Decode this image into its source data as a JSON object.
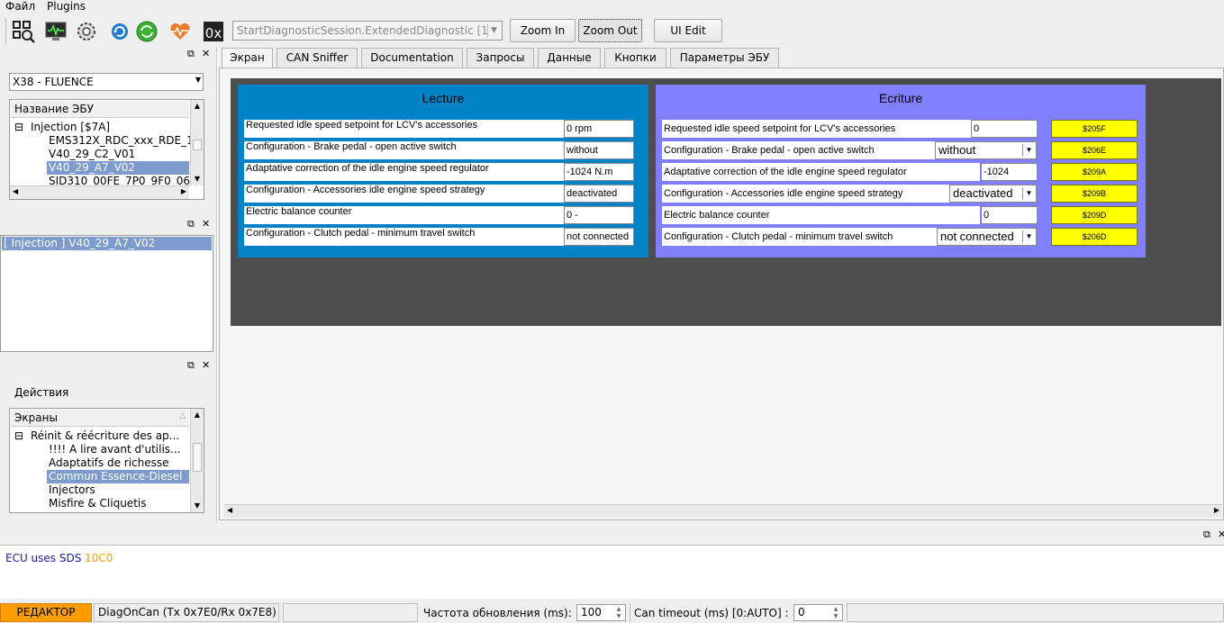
{
  "menu": {
    "file": "Файл",
    "plugins": "Plugins"
  },
  "toolbar": {
    "session_combo": "StartDiagnosticSession.ExtendedDiagnostic [1",
    "hex_label": "0x",
    "zoom_in": "Zoom In",
    "zoom_out": "Zoom Out",
    "ui_edit": "UI Edit"
  },
  "left_top": {
    "vehicle_combo": "X38 - FLUENCE",
    "tree_header": "Название ЭБУ",
    "items": [
      "Injection [$7A]",
      "EMS312X_RDC_xxx_RDE_1",
      "V40_29_C2_V01",
      "V40_29_A7_V02",
      "SID310_00FE_7P0_9F0_06"
    ],
    "selected": "V40_29_A7_V02"
  },
  "left_mid": {
    "list_item": "[ Injection ] V40_29_A7_V02"
  },
  "left_bottom": {
    "actions_label": "Действия",
    "tree_header": "Экраны",
    "items": [
      "Réinit & réécriture des ap...",
      "!!!! A lire avant d'utilis...",
      "Adaptatifs de richesse",
      "Commun Essence-Diesel",
      "Injectors",
      "Misfire & Cliquetis"
    ],
    "selected": "Commun Essence-Diesel"
  },
  "tabs": [
    "Экран",
    "CAN Sniffer",
    "Documentation",
    "Запросы",
    "Данные",
    "Кнопки",
    "Параметры ЭБУ"
  ],
  "lecture": {
    "title": "Lecture",
    "rows": [
      {
        "label": "Requested idle speed setpoint for LCV's accessories",
        "value": "0 rpm"
      },
      {
        "label": "Configuration - Brake pedal - open active switch",
        "value": "without"
      },
      {
        "label": "Adaptative correction of the idle engine speed regulator",
        "value": "-1024 N.m"
      },
      {
        "label": "Configuration - Accessories idle engine speed strategy",
        "value": "deactivated"
      },
      {
        "label": "Electric balance counter",
        "value": "0 -"
      },
      {
        "label": "Configuration - Clutch pedal - minimum travel switch",
        "value": "not connected"
      }
    ]
  },
  "ecriture": {
    "title": "Ecriture",
    "rows": [
      {
        "label": "Requested idle speed setpoint for LCV's accessories",
        "value": "0",
        "button": "$205F"
      },
      {
        "label": "Configuration - Brake pedal - open active switch",
        "value": "without",
        "button": "$206E"
      },
      {
        "label": "Adaptative correction of the idle engine speed regulator",
        "value": "-1024",
        "button": "$209A"
      },
      {
        "label": "Configuration - Accessories idle engine speed strategy",
        "value": "deactivated",
        "button": "$209B"
      },
      {
        "label": "Electric balance counter",
        "value": "0",
        "button": "$209D"
      },
      {
        "label": "Configuration - Clutch pedal - minimum travel switch",
        "value": "not connected",
        "button": "$206D"
      }
    ]
  },
  "log": {
    "text": "ECU uses SDS",
    "code": "10C0"
  },
  "status": {
    "mode": "РЕДАКТОР",
    "protocol": "DiagOnCan (Tx 0x7E0/Rx 0x7E8)",
    "refresh_label": "Частота обновления (ms):",
    "refresh_value": "100",
    "timeout_label": "Can timeout (ms) [0:AUTO] :",
    "timeout_value": "0"
  },
  "colors": {
    "lecture_bg": "#0082c6",
    "ecriture_bg": "#8080ff",
    "button_yellow": "#ffff00",
    "mode_orange": "#ff9c00",
    "selection": "#7d9bcc"
  },
  "icons": [
    "qr-search-icon",
    "monitor-icon",
    "gear-icon",
    "refresh-icon",
    "sync-icon",
    "heartbeat-icon",
    "hex-icon"
  ]
}
